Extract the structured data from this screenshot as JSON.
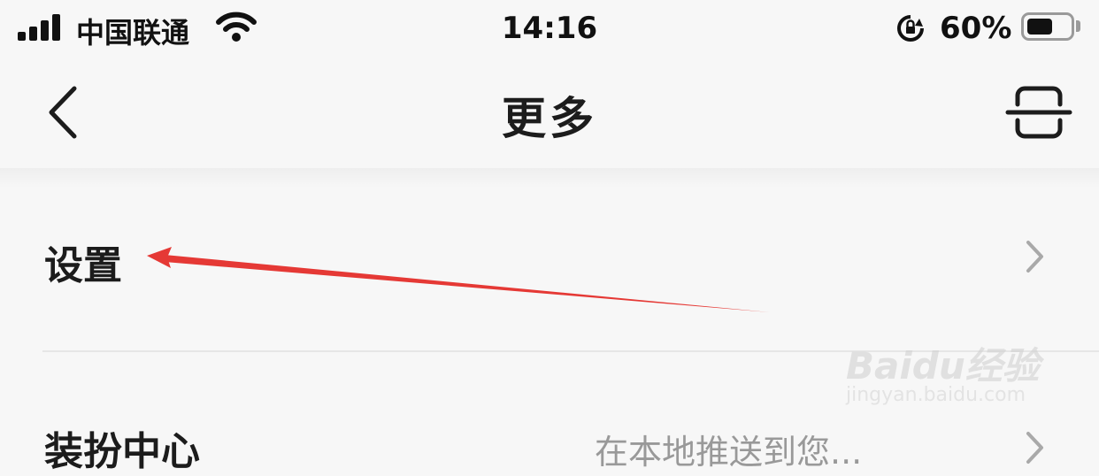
{
  "status_bar": {
    "carrier": "中国联通",
    "time": "14:16",
    "battery_percent": "60%",
    "battery_level": 0.6
  },
  "nav": {
    "title": "更多"
  },
  "list": [
    {
      "label": "设置"
    },
    {
      "label": "装扮中心",
      "value": "在本地推送到您..."
    }
  ],
  "colors": {
    "background": "#f7f7f7",
    "annotation_arrow": "#e53935",
    "text": "#1c1c1c",
    "chevron": "#a9a9a9"
  },
  "watermark": {
    "main": "Baidu经验",
    "sub": "jingyan.baidu.com"
  }
}
